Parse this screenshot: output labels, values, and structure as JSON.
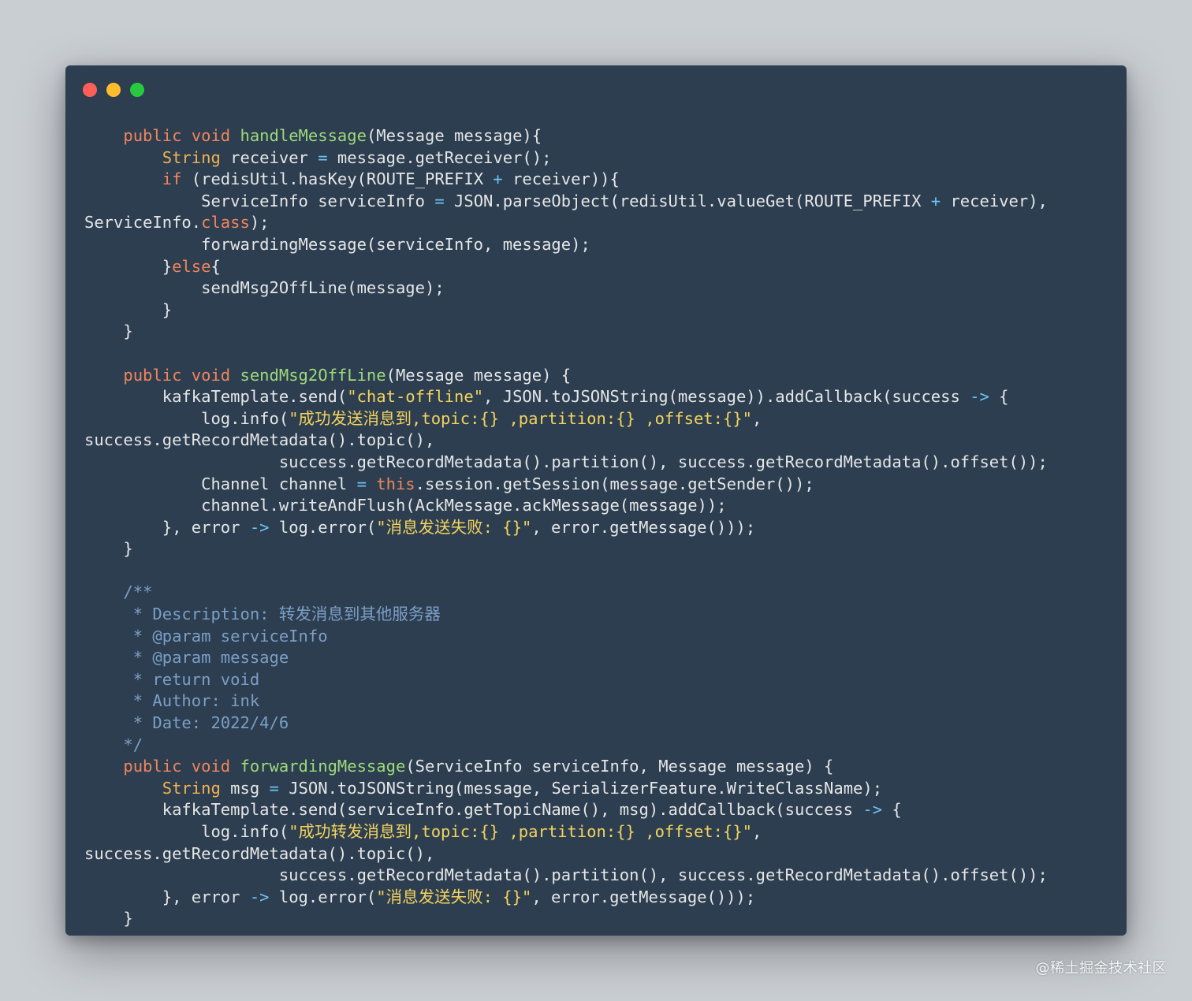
{
  "window": {
    "controls": [
      {
        "name": "close",
        "color": "#ff5f56"
      },
      {
        "name": "minimize",
        "color": "#ffbd2e"
      },
      {
        "name": "zoom",
        "color": "#27c93f"
      }
    ]
  },
  "colors": {
    "background": "#c9ced3",
    "editor": "#2c3e50",
    "keyword": "#f2855b",
    "type": "#f2b14f",
    "function": "#9ed97a",
    "string": "#f4d35e",
    "operator": "#6cc4f2",
    "comment": "#7c9fc6",
    "text": "#e6e6e6"
  },
  "code_lines": [
    [
      [
        "kw",
        "    public "
      ],
      [
        "kw",
        "void "
      ],
      [
        "fn",
        "handleMessage"
      ],
      [
        "plain",
        "(Message message){"
      ]
    ],
    [
      [
        "plain",
        "        "
      ],
      [
        "type",
        "String"
      ],
      [
        "plain",
        " receiver "
      ],
      [
        "op",
        "="
      ],
      [
        "plain",
        " message.getReceiver();"
      ]
    ],
    [
      [
        "plain",
        "        "
      ],
      [
        "kw",
        "if"
      ],
      [
        "plain",
        " (redisUtil.hasKey(ROUTE_PREFIX "
      ],
      [
        "op",
        "+"
      ],
      [
        "plain",
        " receiver)){"
      ]
    ],
    [
      [
        "plain",
        "            ServiceInfo serviceInfo "
      ],
      [
        "op",
        "="
      ],
      [
        "plain",
        " JSON.parseObject(redisUtil.valueGet(ROUTE_PREFIX "
      ],
      [
        "op",
        "+"
      ],
      [
        "plain",
        " receiver),"
      ]
    ],
    [
      [
        "plain",
        "ServiceInfo."
      ],
      [
        "kw",
        "class"
      ],
      [
        "plain",
        ");"
      ]
    ],
    [
      [
        "plain",
        "            forwardingMessage(serviceInfo, message);"
      ]
    ],
    [
      [
        "plain",
        "        }"
      ],
      [
        "kw",
        "else"
      ],
      [
        "plain",
        "{"
      ]
    ],
    [
      [
        "plain",
        "            sendMsg2OffLine(message);"
      ]
    ],
    [
      [
        "plain",
        "        }"
      ]
    ],
    [
      [
        "plain",
        "    }"
      ]
    ],
    [
      [
        "plain",
        ""
      ]
    ],
    [
      [
        "kw",
        "    public "
      ],
      [
        "kw",
        "void "
      ],
      [
        "fn",
        "sendMsg2OffLine"
      ],
      [
        "plain",
        "(Message message) {"
      ]
    ],
    [
      [
        "plain",
        "        kafkaTemplate.send("
      ],
      [
        "str",
        "\"chat-offline\""
      ],
      [
        "plain",
        ", JSON.toJSONString(message)).addCallback(success "
      ],
      [
        "op",
        "->"
      ],
      [
        "plain",
        " {"
      ]
    ],
    [
      [
        "plain",
        "            log.info("
      ],
      [
        "str",
        "\"成功发送消息到,topic:{} ,partition:{} ,offset:{}\""
      ],
      [
        "plain",
        ","
      ]
    ],
    [
      [
        "plain",
        "success.getRecordMetadata().topic(),"
      ]
    ],
    [
      [
        "plain",
        "                    success.getRecordMetadata().partition(), success.getRecordMetadata().offset());"
      ]
    ],
    [
      [
        "plain",
        "            Channel channel "
      ],
      [
        "op",
        "="
      ],
      [
        "plain",
        " "
      ],
      [
        "kw",
        "this"
      ],
      [
        "plain",
        ".session.getSession(message.getSender());"
      ]
    ],
    [
      [
        "plain",
        "            channel.writeAndFlush(AckMessage.ackMessage(message));"
      ]
    ],
    [
      [
        "plain",
        "        }, error "
      ],
      [
        "op",
        "->"
      ],
      [
        "plain",
        " log.error("
      ],
      [
        "str",
        "\"消息发送失败: {}\""
      ],
      [
        "plain",
        ", error.getMessage()));"
      ]
    ],
    [
      [
        "plain",
        "    }"
      ]
    ],
    [
      [
        "plain",
        ""
      ]
    ],
    [
      [
        "cm",
        "    /**"
      ]
    ],
    [
      [
        "cm",
        "     * Description: 转发消息到其他服务器"
      ]
    ],
    [
      [
        "cm",
        "     * @param serviceInfo"
      ]
    ],
    [
      [
        "cm",
        "     * @param message"
      ]
    ],
    [
      [
        "cm",
        "     * return void"
      ]
    ],
    [
      [
        "cm",
        "     * Author: ink"
      ]
    ],
    [
      [
        "cm",
        "     * Date: 2022/4/6"
      ]
    ],
    [
      [
        "cm",
        "    */"
      ]
    ],
    [
      [
        "kw",
        "    public "
      ],
      [
        "kw",
        "void "
      ],
      [
        "fn",
        "forwardingMessage"
      ],
      [
        "plain",
        "(ServiceInfo serviceInfo, Message message) {"
      ]
    ],
    [
      [
        "plain",
        "        "
      ],
      [
        "type",
        "String"
      ],
      [
        "plain",
        " msg "
      ],
      [
        "op",
        "="
      ],
      [
        "plain",
        " JSON.toJSONString(message, SerializerFeature.WriteClassName);"
      ]
    ],
    [
      [
        "plain",
        "        kafkaTemplate.send(serviceInfo.getTopicName(), msg).addCallback(success "
      ],
      [
        "op",
        "->"
      ],
      [
        "plain",
        " {"
      ]
    ],
    [
      [
        "plain",
        "            log.info("
      ],
      [
        "str",
        "\"成功转发消息到,topic:{} ,partition:{} ,offset:{}\""
      ],
      [
        "plain",
        ","
      ]
    ],
    [
      [
        "plain",
        "success.getRecordMetadata().topic(),"
      ]
    ],
    [
      [
        "plain",
        "                    success.getRecordMetadata().partition(), success.getRecordMetadata().offset());"
      ]
    ],
    [
      [
        "plain",
        "        }, error "
      ],
      [
        "op",
        "->"
      ],
      [
        "plain",
        " log.error("
      ],
      [
        "str",
        "\"消息发送失败: {}\""
      ],
      [
        "plain",
        ", error.getMessage()));"
      ]
    ],
    [
      [
        "plain",
        "    }"
      ]
    ]
  ],
  "watermark": "@稀土掘金技术社区"
}
